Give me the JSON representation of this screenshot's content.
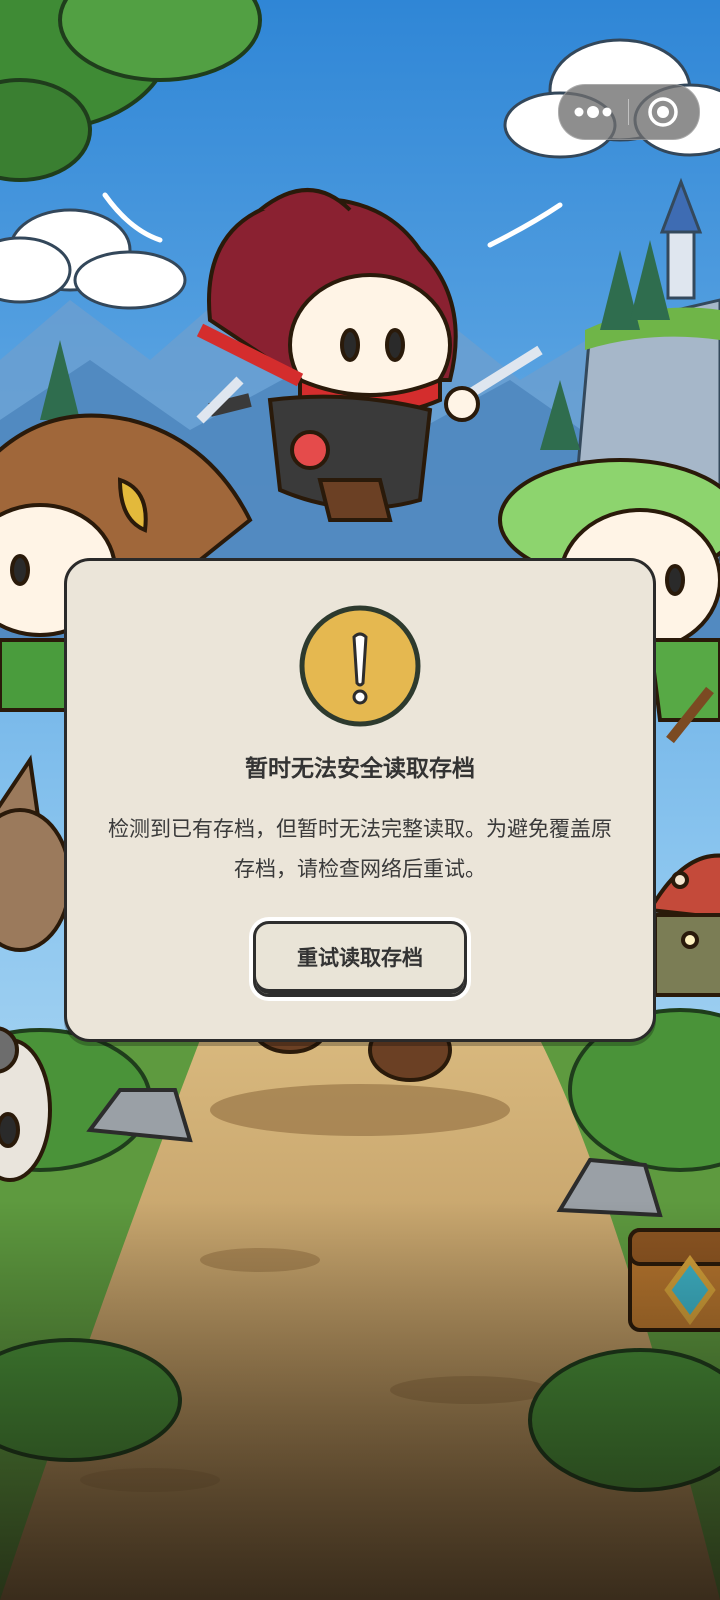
{
  "capsule": {
    "more_icon": "more-dots-icon",
    "close_icon": "target-close-icon"
  },
  "dialog": {
    "icon": "exclamation-icon",
    "title": "暂时无法安全读取存档",
    "message": "检测到已有存档，但暂时无法完整读取。为避免覆盖原存档，请检查网络后重试。",
    "retry_label": "重试读取存档"
  },
  "colors": {
    "dialog_bg": "#ebe5d9",
    "warning_yellow": "#e5b850",
    "outline": "#2a2a2a",
    "text": "#333333"
  }
}
